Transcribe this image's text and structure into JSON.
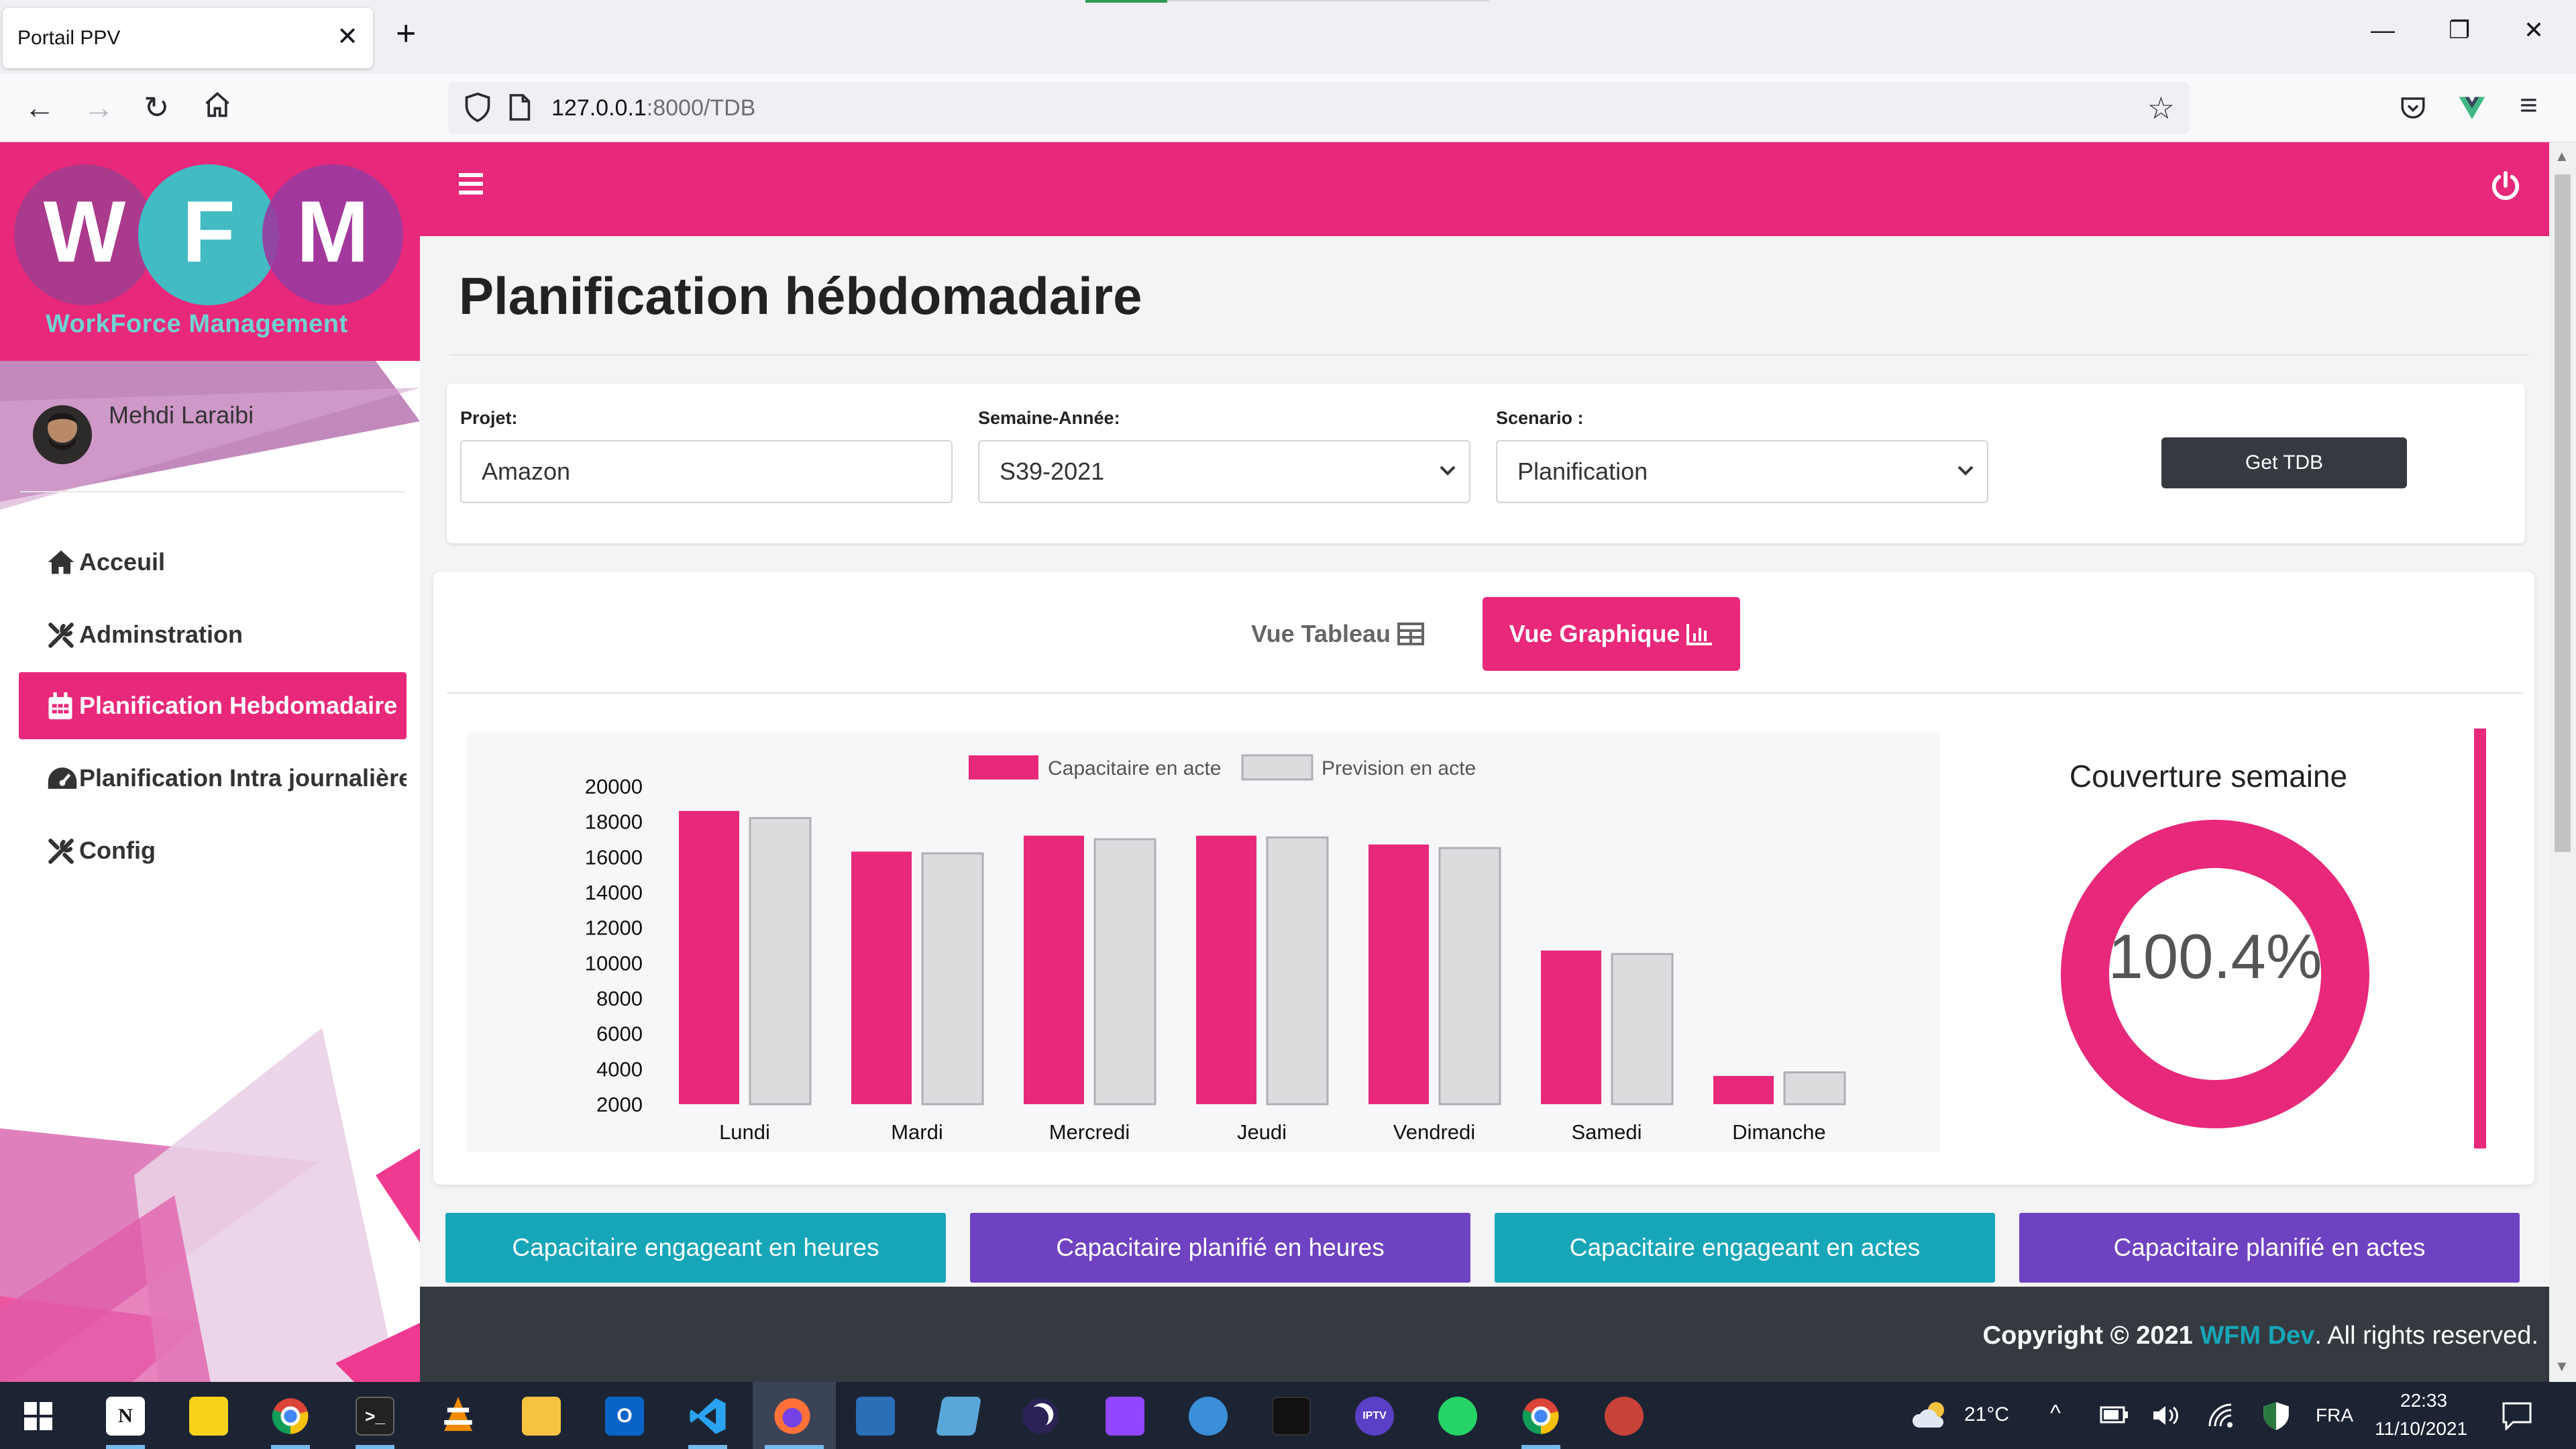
{
  "browser": {
    "tab_title": "Portail PPV",
    "url_host": "127.0.0.1",
    "url_path": ":8000/TDB"
  },
  "sidebar": {
    "logo_letters": [
      "W",
      "F",
      "M"
    ],
    "brand_subtitle": "WorkForce Management",
    "user_name": "Mehdi Laraibi",
    "items": [
      {
        "label": "Acceuil",
        "icon": "home-icon",
        "active": false
      },
      {
        "label": "Adminstration",
        "icon": "tools-icon",
        "active": false
      },
      {
        "label": "Planification Hebdomadaire",
        "icon": "calendar-icon",
        "active": true
      },
      {
        "label": "Planification Intra journalière",
        "icon": "dashboard-icon",
        "active": false
      },
      {
        "label": "Config",
        "icon": "tools-icon",
        "active": false
      }
    ]
  },
  "page": {
    "title": "Planification hébdomadaire"
  },
  "filters": {
    "project_label": "Projet:",
    "project_value": "Amazon",
    "week_label": "Semaine-Année:",
    "week_value": "S39-2021",
    "scenario_label": "Scenario :",
    "scenario_value": "Planification",
    "get_button": "Get TDB"
  },
  "views": {
    "table_label": "Vue Tableau",
    "graph_label": "Vue Graphique"
  },
  "chart_data": {
    "type": "bar",
    "categories": [
      "Lundi",
      "Mardi",
      "Mercredi",
      "Jeudi",
      "Vendredi",
      "Samedi",
      "Dimanche"
    ],
    "series": [
      {
        "name": "Capacitaire en acte",
        "color": "#e8287a",
        "values": [
          18600,
          16300,
          17200,
          17200,
          16700,
          10700,
          3600
        ]
      },
      {
        "name": "Prevision en acte",
        "color": "#dcdcdf",
        "values": [
          18200,
          16200,
          17000,
          17100,
          16500,
          10500,
          3800
        ]
      }
    ],
    "y_ticks": [
      "20000",
      "18000",
      "16000",
      "14000",
      "12000",
      "10000",
      "8000",
      "6000",
      "4000",
      "2000"
    ],
    "ylim": [
      2000,
      20000
    ],
    "legend": "top"
  },
  "coverage": {
    "title": "Couverture semaine",
    "value": "100.4%",
    "color": "#e8287a"
  },
  "bottom_buttons": [
    {
      "label": "Capacitaire engageant en heures",
      "color": "teal"
    },
    {
      "label": "Capacitaire planifié en heures",
      "color": "purple"
    },
    {
      "label": "Capacitaire engageant en actes",
      "color": "teal"
    },
    {
      "label": "Capacitaire planifié en actes",
      "color": "purple"
    }
  ],
  "footer": {
    "prefix": "Copyright © 2021",
    "brand": "WFM Dev",
    "suffix": ". All rights reserved."
  },
  "taskbar": {
    "weather": "21°C",
    "language": "FRA",
    "time": "22:33",
    "date": "11/10/2021",
    "notion_letter": "N",
    "iptv_label": "IPTV"
  }
}
